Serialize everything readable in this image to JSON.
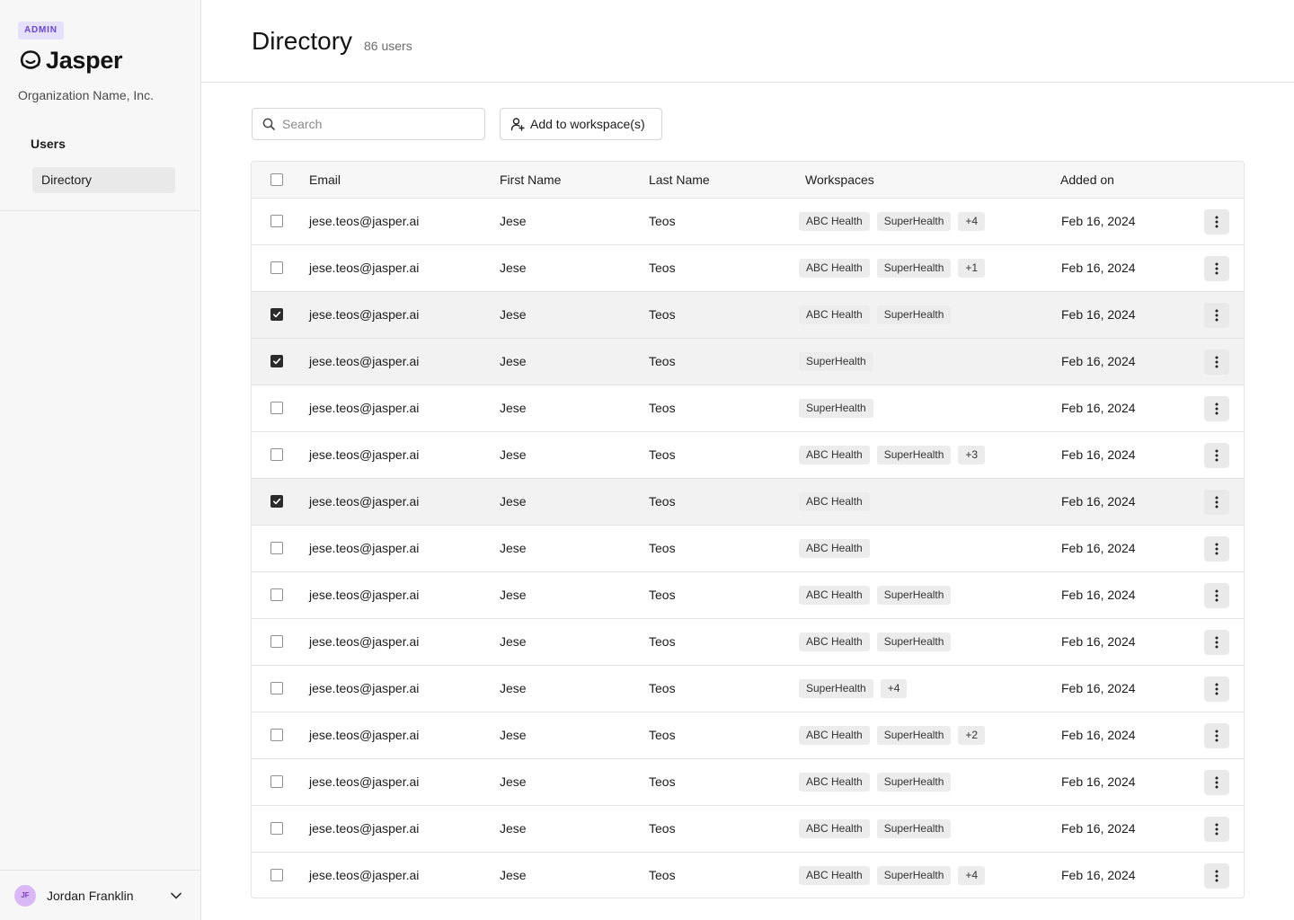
{
  "sidebar": {
    "badge": "ADMIN",
    "logo_text": "Jasper",
    "org_name": "Organization Name, Inc.",
    "section_label": "Users",
    "nav_item": "Directory",
    "user": {
      "initials": "JF",
      "name": "Jordan Franklin"
    }
  },
  "header": {
    "title": "Directory",
    "count": "86 users"
  },
  "toolbar": {
    "search_placeholder": "Search",
    "search_value": "",
    "add_button": "Add to workspace(s)"
  },
  "table": {
    "columns": {
      "email": "Email",
      "first": "First Name",
      "last": "Last Name",
      "workspaces": "Workspaces",
      "added": "Added on"
    },
    "rows": [
      {
        "checked": false,
        "email": "jese.teos@jasper.ai",
        "first": "Jese",
        "last": "Teos",
        "tags": [
          "ABC Health",
          "SuperHealth",
          "+4"
        ],
        "added": "Feb 16, 2024"
      },
      {
        "checked": false,
        "email": "jese.teos@jasper.ai",
        "first": "Jese",
        "last": "Teos",
        "tags": [
          "ABC Health",
          "SuperHealth",
          "+1"
        ],
        "added": "Feb 16, 2024"
      },
      {
        "checked": true,
        "email": "jese.teos@jasper.ai",
        "first": "Jese",
        "last": "Teos",
        "tags": [
          "ABC Health",
          "SuperHealth"
        ],
        "added": "Feb 16, 2024"
      },
      {
        "checked": true,
        "email": "jese.teos@jasper.ai",
        "first": "Jese",
        "last": "Teos",
        "tags": [
          "SuperHealth"
        ],
        "added": "Feb 16, 2024"
      },
      {
        "checked": false,
        "email": "jese.teos@jasper.ai",
        "first": "Jese",
        "last": "Teos",
        "tags": [
          "SuperHealth"
        ],
        "added": "Feb 16, 2024"
      },
      {
        "checked": false,
        "email": "jese.teos@jasper.ai",
        "first": "Jese",
        "last": "Teos",
        "tags": [
          "ABC Health",
          "SuperHealth",
          "+3"
        ],
        "added": "Feb 16, 2024"
      },
      {
        "checked": true,
        "email": "jese.teos@jasper.ai",
        "first": "Jese",
        "last": "Teos",
        "tags": [
          "ABC Health"
        ],
        "added": "Feb 16, 2024"
      },
      {
        "checked": false,
        "email": "jese.teos@jasper.ai",
        "first": "Jese",
        "last": "Teos",
        "tags": [
          "ABC Health"
        ],
        "added": "Feb 16, 2024"
      },
      {
        "checked": false,
        "email": "jese.teos@jasper.ai",
        "first": "Jese",
        "last": "Teos",
        "tags": [
          "ABC Health",
          "SuperHealth"
        ],
        "added": "Feb 16, 2024"
      },
      {
        "checked": false,
        "email": "jese.teos@jasper.ai",
        "first": "Jese",
        "last": "Teos",
        "tags": [
          "ABC Health",
          "SuperHealth"
        ],
        "added": "Feb 16, 2024"
      },
      {
        "checked": false,
        "email": "jese.teos@jasper.ai",
        "first": "Jese",
        "last": "Teos",
        "tags": [
          "SuperHealth",
          "+4"
        ],
        "added": "Feb 16, 2024"
      },
      {
        "checked": false,
        "email": "jese.teos@jasper.ai",
        "first": "Jese",
        "last": "Teos",
        "tags": [
          "ABC Health",
          "SuperHealth",
          "+2"
        ],
        "added": "Feb 16, 2024"
      },
      {
        "checked": false,
        "email": "jese.teos@jasper.ai",
        "first": "Jese",
        "last": "Teos",
        "tags": [
          "ABC Health",
          "SuperHealth"
        ],
        "added": "Feb 16, 2024"
      },
      {
        "checked": false,
        "email": "jese.teos@jasper.ai",
        "first": "Jese",
        "last": "Teos",
        "tags": [
          "ABC Health",
          "SuperHealth"
        ],
        "added": "Feb 16, 2024"
      },
      {
        "checked": false,
        "email": "jese.teos@jasper.ai",
        "first": "Jese",
        "last": "Teos",
        "tags": [
          "ABC Health",
          "SuperHealth",
          "+4"
        ],
        "added": "Feb 16, 2024"
      }
    ]
  },
  "icons": {
    "logo": "jasper-logo-icon",
    "search": "search-icon",
    "add_user": "add-user-icon",
    "more": "kebab-menu-icon",
    "chevron": "chevron-down-icon",
    "check": "check-icon"
  },
  "colors": {
    "accent": "#6b45d8",
    "badge_bg": "#e6e1fb",
    "selected_row": "#f2f2f2",
    "checkbox_checked": "#2b2b2b",
    "avatar_bg": "#d9b8f5"
  }
}
